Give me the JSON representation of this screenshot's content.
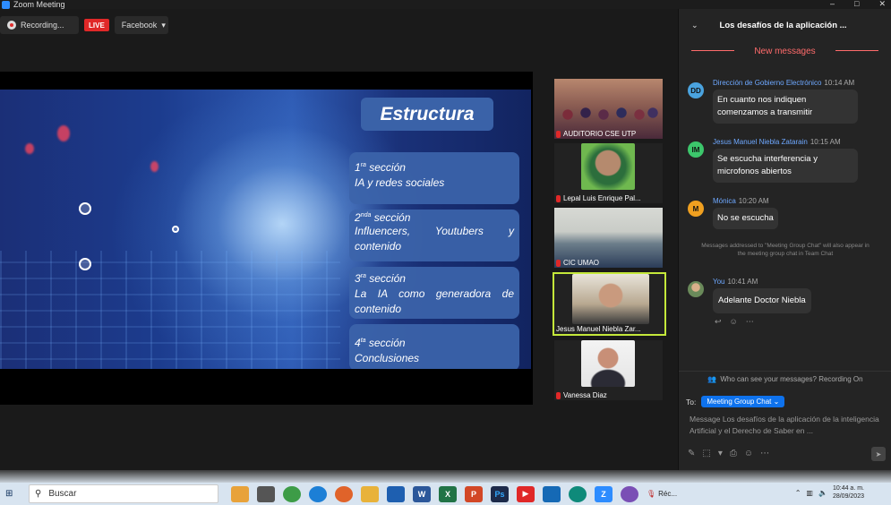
{
  "window": {
    "title": "Zoom Meeting",
    "controls": [
      "–",
      "□",
      "✕"
    ]
  },
  "topbar": {
    "recording_label": "Recording...",
    "live_label": "LIVE",
    "stream_label": "Facebook",
    "stream_caret": "▾"
  },
  "slide": {
    "title": "Estructura",
    "sections": [
      {
        "ord": "1",
        "sup": "ra",
        "head": " sección",
        "body": "IA y redes sociales"
      },
      {
        "ord": "2",
        "sup": "nda",
        "head": " sección",
        "body": "Influencers, Youtubers y contenido"
      },
      {
        "ord": "3",
        "sup": "ra",
        "head": " sección",
        "body": "La IA como generadora de contenido"
      },
      {
        "ord": "4",
        "sup": "ta",
        "head": " sección",
        "body": "Conclusiones"
      }
    ]
  },
  "participants": [
    {
      "name": "AUDITORIO CSE UTP"
    },
    {
      "name": "Lepal Luis Enrique Pal..."
    },
    {
      "name": "CIC UMAO"
    },
    {
      "name": "Jesus Manuel Niebla Zar..."
    },
    {
      "name": "Vanessa Diaz"
    }
  ],
  "chat": {
    "header_chevron": "⌄",
    "title": "Los desafíos de la aplicación ...",
    "new_messages_label": "New messages",
    "messages": [
      {
        "initials": "DD",
        "color": "#4aa3df",
        "sender": "Dirección de Gobierno Electrónico",
        "time": "10:14 AM",
        "text": "En cuanto nos indiquen comenzamos a transmitir"
      },
      {
        "initials": "IM",
        "color": "#3cc66b",
        "sender": "Jesus Manuel Niebla Zatarain",
        "time": "10:15 AM",
        "text": "Se escucha interferencia y microfonos abiertos"
      },
      {
        "initials": "M",
        "color": "#f0a020",
        "sender": "Mónica",
        "time": "10:20 AM",
        "text": "No se escucha"
      },
      {
        "initials": "",
        "color": "#7a9a6a",
        "sender": "You",
        "time": "10:41 AM",
        "text": "Adelante Doctor Niebla"
      }
    ],
    "system_note": "Messages addressed to \"Meeting Group Chat\" will also appear in the meeting group chat in Team Chat",
    "who_can_see": "Who can see your messages? Recording On",
    "to_label": "To:",
    "to_recipient": "Meeting Group Chat ⌄",
    "compose_placeholder": "Message Los desafíos de la aplicación de la inteligencia Artificial y el Derecho de Saber en ...",
    "compose_tools": [
      "✎",
      "⬚",
      "▾",
      "⎙",
      "☺",
      "⋯"
    ],
    "send_icon": "➤"
  },
  "taskbar": {
    "search_placeholder": "Buscar",
    "apps": [
      {
        "label": "",
        "color": "#e8a23a"
      },
      {
        "label": "",
        "color": "#555"
      },
      {
        "label": "",
        "color": "#3d9c47"
      },
      {
        "label": "",
        "color": "#1c7fd6"
      },
      {
        "label": "",
        "color": "#e0632a"
      },
      {
        "label": "",
        "color": "#e8b23a"
      },
      {
        "label": "",
        "color": "#1e5fb0"
      },
      {
        "label": "W",
        "color": "#2b579a"
      },
      {
        "label": "X",
        "color": "#217346"
      },
      {
        "label": "P",
        "color": "#d24726"
      },
      {
        "label": "Ps",
        "color": "#1c2a4a"
      },
      {
        "label": "▶",
        "color": "#e02828"
      },
      {
        "label": "",
        "color": "#1569b5"
      },
      {
        "label": "",
        "color": "#0e8a7a"
      },
      {
        "label": "Z",
        "color": "#2d8cff"
      },
      {
        "label": "",
        "color": "#7a4fb5"
      }
    ],
    "recording_task": "Réc...",
    "time": "10:44 a. m.",
    "date": "28/09/2023"
  }
}
